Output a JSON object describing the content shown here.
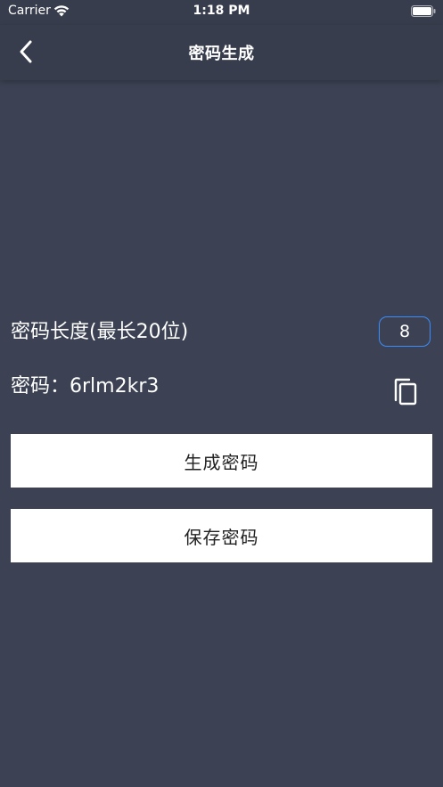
{
  "status_bar": {
    "carrier": "Carrier",
    "time": "1:18 PM",
    "wifi_icon": "wifi-icon",
    "battery_icon": "battery-icon"
  },
  "nav": {
    "title": "密码生成",
    "back_icon": "chevron-left-icon"
  },
  "settings": {
    "length_label": "密码长度(最长20位)",
    "length_value": "8"
  },
  "password": {
    "prefix": "密码：",
    "value": "6rlm2kr3",
    "copy_icon": "copy-icon"
  },
  "actions": {
    "generate_label": "生成密码",
    "save_label": "保存密码"
  },
  "colors": {
    "background": "#3c4253",
    "header": "#383d4d",
    "input_border": "#3a8dff",
    "button_bg": "#ffffff",
    "button_text": "#222222"
  }
}
